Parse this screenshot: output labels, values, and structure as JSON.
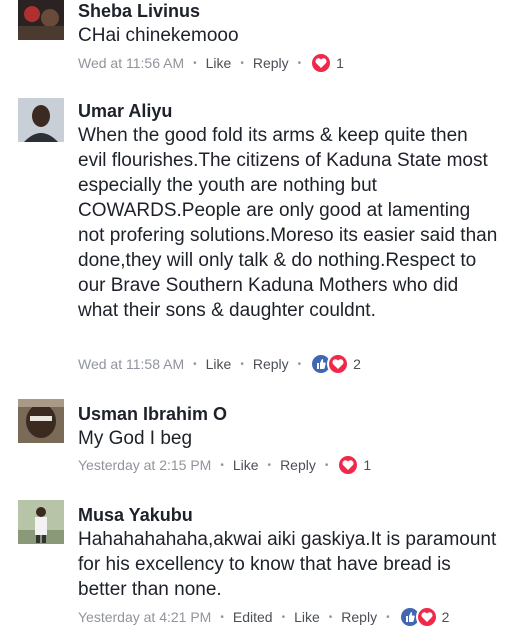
{
  "comments": [
    {
      "author": "Sheba Livinus",
      "text": "CHai chinekemooo",
      "time": "Wed at 11:56 AM",
      "edited": "",
      "like_label": "Like",
      "reply_label": "Reply",
      "reactions": [
        "love"
      ],
      "reaction_count": "1",
      "avatar": {
        "bg": "#3a2a2a",
        "accent": "#b03030"
      }
    },
    {
      "author": "Umar Aliyu",
      "text": "When the good fold its arms & keep quite then evil flourishes.The citizens of Kaduna State most especially the youth are nothing but COWARDS.People are only good at lamenting not profering solutions.Moreso its easier said than done,they will only talk & do nothing.Respect to our Brave Southern Kaduna Mothers who did what their sons & daughter couldnt.",
      "time": "Wed at 11:58 AM",
      "edited": "",
      "like_label": "Like",
      "reply_label": "Reply",
      "reactions": [
        "like",
        "love"
      ],
      "reaction_count": "2",
      "avatar": {
        "bg": "#c9cfd6",
        "accent": "#3b2a22"
      }
    },
    {
      "author": "Usman Ibrahim O",
      "text": "My God I beg",
      "time": "Yesterday at 2:15 PM",
      "edited": "",
      "like_label": "Like",
      "reply_label": "Reply",
      "reactions": [
        "love"
      ],
      "reaction_count": "1",
      "avatar": {
        "bg": "#6b5a4a",
        "accent": "#2a1e18"
      }
    },
    {
      "author": "Musa Yakubu",
      "text": "Hahahahahaha,akwai aiki gaskiya.It is paramount for his excellency to know that have bread is better than none.",
      "time": "Yesterday at 4:21 PM",
      "edited": "Edited",
      "like_label": "Like",
      "reply_label": "Reply",
      "reactions": [
        "like",
        "love"
      ],
      "reaction_count": "2",
      "avatar": {
        "bg": "#a9b79a",
        "accent": "#e8e8e8"
      }
    }
  ],
  "colors": {
    "like": "#4267b2",
    "love": "#f0284a",
    "meta": "#90949c"
  }
}
